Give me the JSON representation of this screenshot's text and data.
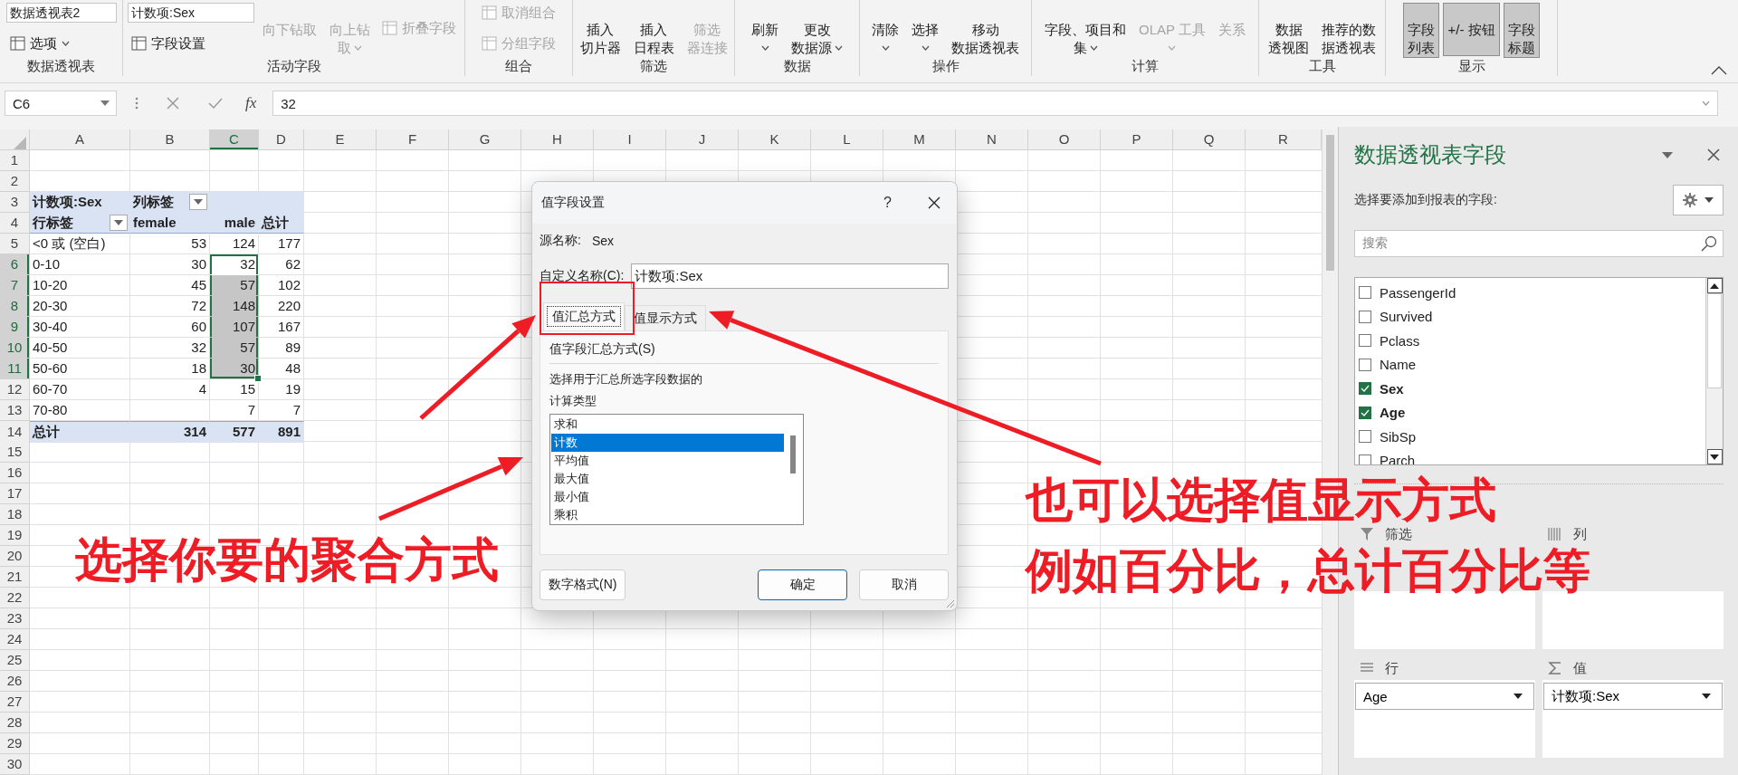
{
  "ribbon": {
    "groups": [
      {
        "label": "数据透视表",
        "columns": [
          {
            "items": [
              {
                "kind": "field",
                "value": "数据透视表2"
              },
              {
                "kind": "small",
                "label": "选项",
                "disabled": false,
                "menu": true
              }
            ]
          }
        ]
      },
      {
        "label": "活动字段",
        "columns": [
          {
            "items": [
              {
                "kind": "field",
                "value": "计数项:Sex"
              },
              {
                "kind": "small",
                "label": "字段设置",
                "disabled": false,
                "menu": false
              }
            ]
          },
          {
            "items": [
              {
                "kind": "large",
                "lines": [
                  "向下钻取"
                ],
                "disabled": true,
                "menu": false
              }
            ]
          },
          {
            "items": [
              {
                "kind": "large",
                "lines": [
                  "向上钻",
                  "取"
                ],
                "disabled": true,
                "menu": true
              }
            ]
          },
          {
            "items": [
              {
                "kind": "small",
                "label": "折叠字段",
                "disabled": true,
                "menu": false
              }
            ]
          }
        ]
      },
      {
        "label": "组合",
        "columns": [
          {
            "items": [
              {
                "kind": "small",
                "label": "取消组合",
                "disabled": true,
                "menu": false
              },
              {
                "kind": "small",
                "label": "分组字段",
                "disabled": true,
                "menu": false
              }
            ]
          }
        ]
      },
      {
        "label": "筛选",
        "columns": [
          {
            "items": [
              {
                "kind": "large",
                "lines": [
                  "插入",
                  "切片器"
                ],
                "disabled": false,
                "menu": false
              }
            ]
          },
          {
            "items": [
              {
                "kind": "large",
                "lines": [
                  "插入",
                  "日程表"
                ],
                "disabled": false,
                "menu": false
              }
            ]
          },
          {
            "items": [
              {
                "kind": "large",
                "lines": [
                  "筛选",
                  "器连接"
                ],
                "disabled": true,
                "menu": false
              }
            ]
          }
        ]
      },
      {
        "label": "数据",
        "columns": [
          {
            "items": [
              {
                "kind": "large",
                "lines": [
                  "刷新"
                ],
                "disabled": false,
                "menu": true
              }
            ]
          },
          {
            "items": [
              {
                "kind": "large",
                "lines": [
                  "更改",
                  "数据源"
                ],
                "disabled": false,
                "menu": true
              }
            ]
          }
        ]
      },
      {
        "label": "操作",
        "columns": [
          {
            "items": [
              {
                "kind": "large",
                "lines": [
                  "清除"
                ],
                "disabled": false,
                "menu": true
              }
            ]
          },
          {
            "items": [
              {
                "kind": "large",
                "lines": [
                  "选择"
                ],
                "disabled": false,
                "menu": true
              }
            ]
          },
          {
            "items": [
              {
                "kind": "large",
                "lines": [
                  "移动",
                  "数据透视表"
                ],
                "disabled": false,
                "menu": false
              }
            ]
          }
        ]
      },
      {
        "label": "计算",
        "columns": [
          {
            "items": [
              {
                "kind": "large",
                "lines": [
                  "字段、项目和",
                  "集"
                ],
                "disabled": false,
                "menu": true
              }
            ]
          },
          {
            "items": [
              {
                "kind": "large",
                "lines": [
                  "OLAP 工具"
                ],
                "disabled": true,
                "menu": true
              }
            ]
          },
          {
            "items": [
              {
                "kind": "large",
                "lines": [
                  "关系"
                ],
                "disabled": true,
                "menu": false
              }
            ]
          }
        ]
      },
      {
        "label": "工具",
        "columns": [
          {
            "items": [
              {
                "kind": "large",
                "lines": [
                  "数据",
                  "透视图"
                ],
                "disabled": false,
                "menu": false
              }
            ]
          },
          {
            "items": [
              {
                "kind": "large",
                "lines": [
                  "推荐的数",
                  "据透视表"
                ],
                "disabled": false,
                "menu": false
              }
            ]
          }
        ]
      },
      {
        "label": "显示",
        "columns": [
          {
            "items": [
              {
                "kind": "large",
                "lines": [
                  "字段",
                  "列表"
                ],
                "disabled": false,
                "menu": false,
                "pressed": true
              }
            ]
          },
          {
            "items": [
              {
                "kind": "large",
                "lines": [
                  "+/- 按钮"
                ],
                "disabled": false,
                "menu": false,
                "pressed": true
              }
            ]
          },
          {
            "items": [
              {
                "kind": "large",
                "lines": [
                  "字段",
                  "标题"
                ],
                "disabled": false,
                "menu": false,
                "pressed": true
              }
            ]
          }
        ]
      }
    ]
  },
  "formula_bar": {
    "name_box": "C6",
    "function_label": "fx",
    "formula": "32"
  },
  "sheet": {
    "columns": [
      "A",
      "B",
      "C",
      "D",
      "E",
      "F",
      "G",
      "H",
      "I",
      "J",
      "K",
      "L",
      "M",
      "N",
      "O",
      "P",
      "Q",
      "R"
    ],
    "rows": [
      "1",
      "2",
      "3",
      "4",
      "5",
      "6",
      "7",
      "8",
      "9",
      "10",
      "11",
      "12",
      "13",
      "14",
      "15",
      "16",
      "17",
      "18",
      "19",
      "20",
      "21",
      "22",
      "23",
      "24",
      "25",
      "26",
      "27",
      "28",
      "29",
      "30"
    ]
  },
  "pivot": {
    "title": "计数项:Sex",
    "column_label": "列标签",
    "header": [
      "行标签",
      "female",
      "male",
      "总计"
    ],
    "rows": [
      {
        "label": "<0 或 (空白)",
        "values": [
          {
            "text": "53",
            "selected": false
          },
          {
            "text": "124",
            "selected": false
          },
          {
            "text": "177",
            "selected": false
          }
        ]
      },
      {
        "label": "0-10",
        "values": [
          {
            "text": "30",
            "selected": false
          },
          {
            "text": "32",
            "selected": true
          },
          {
            "text": "62",
            "selected": false
          }
        ]
      },
      {
        "label": "10-20",
        "values": [
          {
            "text": "45",
            "selected": false
          },
          {
            "text": "57",
            "selected": true
          },
          {
            "text": "102",
            "selected": false
          }
        ]
      },
      {
        "label": "20-30",
        "values": [
          {
            "text": "72",
            "selected": false
          },
          {
            "text": "148",
            "selected": true
          },
          {
            "text": "220",
            "selected": false
          }
        ]
      },
      {
        "label": "30-40",
        "values": [
          {
            "text": "60",
            "selected": false
          },
          {
            "text": "107",
            "selected": true
          },
          {
            "text": "167",
            "selected": false
          }
        ]
      },
      {
        "label": "40-50",
        "values": [
          {
            "text": "32",
            "selected": false
          },
          {
            "text": "57",
            "selected": true
          },
          {
            "text": "89",
            "selected": false
          }
        ]
      },
      {
        "label": "50-60",
        "values": [
          {
            "text": "18",
            "selected": false
          },
          {
            "text": "30",
            "selected": true
          },
          {
            "text": "48",
            "selected": false
          }
        ]
      },
      {
        "label": "60-70",
        "values": [
          {
            "text": "4",
            "selected": false
          },
          {
            "text": "15",
            "selected": false
          },
          {
            "text": "19",
            "selected": false
          }
        ]
      },
      {
        "label": "70-80",
        "values": [
          {
            "selected": false
          },
          {
            "text": "7",
            "selected": false
          },
          {
            "text": "7",
            "selected": false
          }
        ]
      }
    ],
    "total": {
      "label": "总计",
      "values": [
        "314",
        "577",
        "891"
      ]
    }
  },
  "dialog": {
    "title": "值字段设置",
    "help": "?",
    "source_label": "源名称:",
    "source_value": "Sex",
    "custom_name_label": "自定义名称(C):",
    "custom_name_value": "计数项:Sex",
    "tabs": [
      {
        "label": "值汇总方式",
        "selected": true
      },
      {
        "label": "值显示方式",
        "selected": false
      }
    ],
    "section_title": "值字段汇总方式(S)",
    "description": "选择用于汇总所选字段数据的",
    "list_label": "计算类型",
    "functions": [
      {
        "label": "求和",
        "selected": false
      },
      {
        "label": "计数",
        "selected": true
      },
      {
        "label": "平均值",
        "selected": false
      },
      {
        "label": "最大值",
        "selected": false
      },
      {
        "label": "最小值",
        "selected": false
      },
      {
        "label": "乘积",
        "selected": false
      }
    ],
    "buttons": [
      {
        "label": "数字格式(N)",
        "kind": "secondary"
      },
      {
        "label": "确定",
        "kind": "default"
      },
      {
        "label": "取消",
        "kind": "secondary"
      }
    ]
  },
  "field_panel": {
    "title": "数据透视表字段",
    "subtitle": "选择要添加到报表的字段:",
    "search": {
      "placeholder": "搜索"
    },
    "fields": [
      {
        "label": "PassengerId",
        "checked": false
      },
      {
        "label": "Survived",
        "checked": false
      },
      {
        "label": "Pclass",
        "checked": false
      },
      {
        "label": "Name",
        "checked": false
      },
      {
        "label": "Sex",
        "checked": true
      },
      {
        "label": "Age",
        "checked": true
      },
      {
        "label": "SibSp",
        "checked": false
      },
      {
        "label": "Parch",
        "checked": false
      }
    ],
    "areas": [
      {
        "kind": "filter",
        "label": "筛选"
      },
      {
        "kind": "columns",
        "label": "列"
      },
      {
        "kind": "rows",
        "label": "行",
        "items": [
          "Age"
        ]
      },
      {
        "kind": "values",
        "label": "值",
        "items": [
          "计数项:Sex"
        ]
      }
    ]
  },
  "annotations": [
    {
      "lines": [
        "选择你要的聚合方式"
      ]
    },
    {
      "lines": [
        "也可以选择值显示方式",
        "例如百分比，总计百分比等"
      ]
    }
  ]
}
